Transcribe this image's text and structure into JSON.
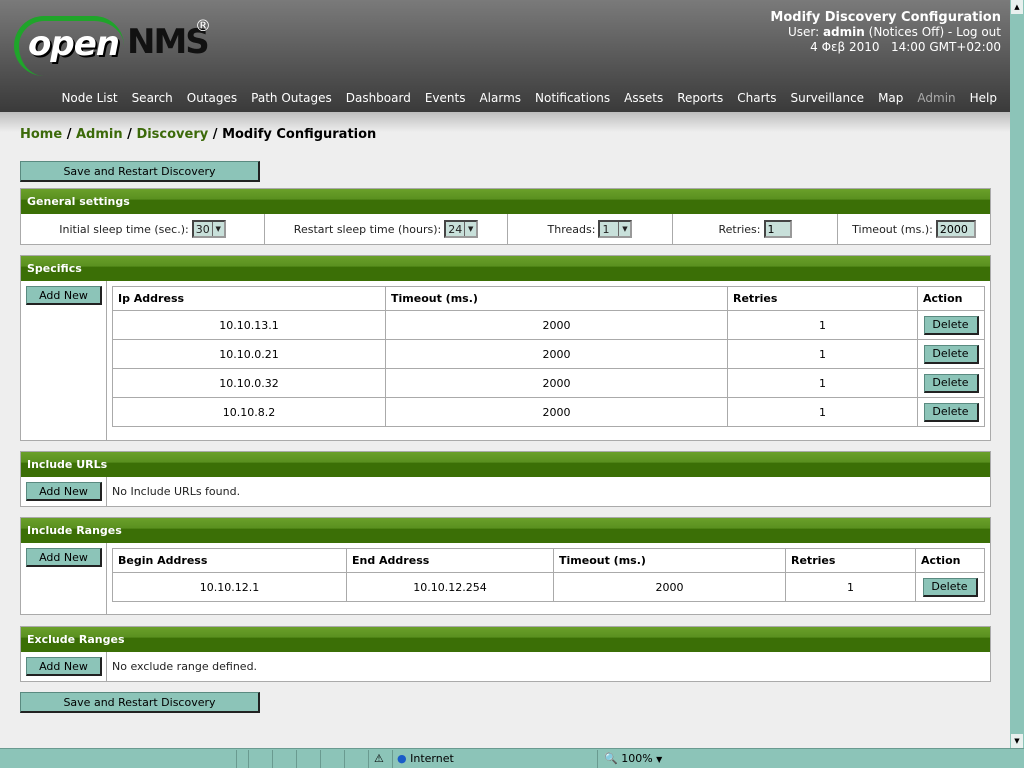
{
  "header": {
    "logo_text": "openNMS®",
    "title": "Modify Discovery Configuration",
    "user_label": "User:",
    "user": "admin",
    "notices": "(Notices Off) -",
    "logout": "Log out",
    "datetime": "4 Φεβ 2010   14:00 GMT+02:00"
  },
  "nav": [
    {
      "label": "Node List"
    },
    {
      "label": "Search"
    },
    {
      "label": "Outages"
    },
    {
      "label": "Path Outages"
    },
    {
      "label": "Dashboard"
    },
    {
      "label": "Events"
    },
    {
      "label": "Alarms"
    },
    {
      "label": "Notifications"
    },
    {
      "label": "Assets"
    },
    {
      "label": "Reports"
    },
    {
      "label": "Charts"
    },
    {
      "label": "Surveillance"
    },
    {
      "label": "Map"
    },
    {
      "label": "Admin",
      "disabled": true
    },
    {
      "label": "Help"
    }
  ],
  "breadcrumb": {
    "home": "Home",
    "admin": "Admin",
    "discovery": "Discovery",
    "current": "Modify Configuration",
    "sep": " / "
  },
  "save_label": "Save and Restart Discovery",
  "add_new": "Add New",
  "delete": "Delete",
  "general": {
    "title": "General settings",
    "initial_label": "Initial sleep time (sec.):",
    "initial": "30",
    "restart_label": "Restart sleep time (hours):",
    "restart": "24",
    "threads_label": "Threads:",
    "threads": "1",
    "retries_label": "Retries:",
    "retries": "1",
    "timeout_label": "Timeout (ms.):",
    "timeout": "2000"
  },
  "specifics": {
    "title": "Specifics",
    "columns": [
      "Ip Address",
      "Timeout (ms.)",
      "Retries",
      "Action"
    ],
    "rows": [
      [
        "10.10.13.1",
        "2000",
        "1"
      ],
      [
        "10.10.0.21",
        "2000",
        "1"
      ],
      [
        "10.10.0.32",
        "2000",
        "1"
      ],
      [
        "10.10.8.2",
        "2000",
        "1"
      ]
    ]
  },
  "include_urls": {
    "title": "Include URLs",
    "empty": "No Include URLs found."
  },
  "include_ranges": {
    "title": "Include Ranges",
    "columns": [
      "Begin Address",
      "End Address",
      "Timeout (ms.)",
      "Retries",
      "Action"
    ],
    "rows": [
      [
        "10.10.12.1",
        "10.10.12.254",
        "2000",
        "1"
      ]
    ]
  },
  "exclude_ranges": {
    "title": "Exclude Ranges",
    "empty": "No exclude range defined."
  },
  "statusbar": {
    "zone": "Internet",
    "zoom": "100%"
  }
}
